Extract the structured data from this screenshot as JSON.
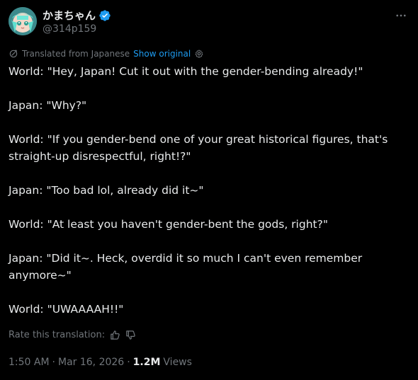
{
  "author": {
    "display_name": "かまちゃん",
    "handle": "@314p159",
    "verified": true,
    "verified_color": "#1d9bf0"
  },
  "translation": {
    "label": "Translated from Japanese",
    "show_original": "Show original"
  },
  "tweet": {
    "lines": [
      "World: \"Hey, Japan! Cut it out with the gender-bending already!\"",
      "Japan: \"Why?\"",
      "World: \"If you gender-bend one of your great historical figures, that's straight-up disrespectful, right!?\"",
      "Japan: \"Too bad lol, already did it~\"",
      "World: \"At least you haven't gender-bent the gods, right?\"",
      "Japan: \"Did it~. Heck, overdid it so much I can't even remember anymore~\"",
      "World: \"UWAAAAH!!\""
    ]
  },
  "rating": {
    "label": "Rate this translation:"
  },
  "meta": {
    "time": "1:50 AM",
    "separator": "·",
    "date": "Mar 16, 2026",
    "views_count": "1.2M",
    "views_label": "Views"
  },
  "colors": {
    "background": "#000000",
    "text": "#e7e9ea",
    "muted": "#71767b",
    "accent": "#1d9bf0"
  },
  "icons": {
    "more": "more-horizontal-icon",
    "translate": "translate-icon",
    "settings": "gear-icon",
    "thumbs_up": "thumbs-up-icon",
    "thumbs_down": "thumbs-down-icon",
    "verified": "verified-badge-icon"
  }
}
